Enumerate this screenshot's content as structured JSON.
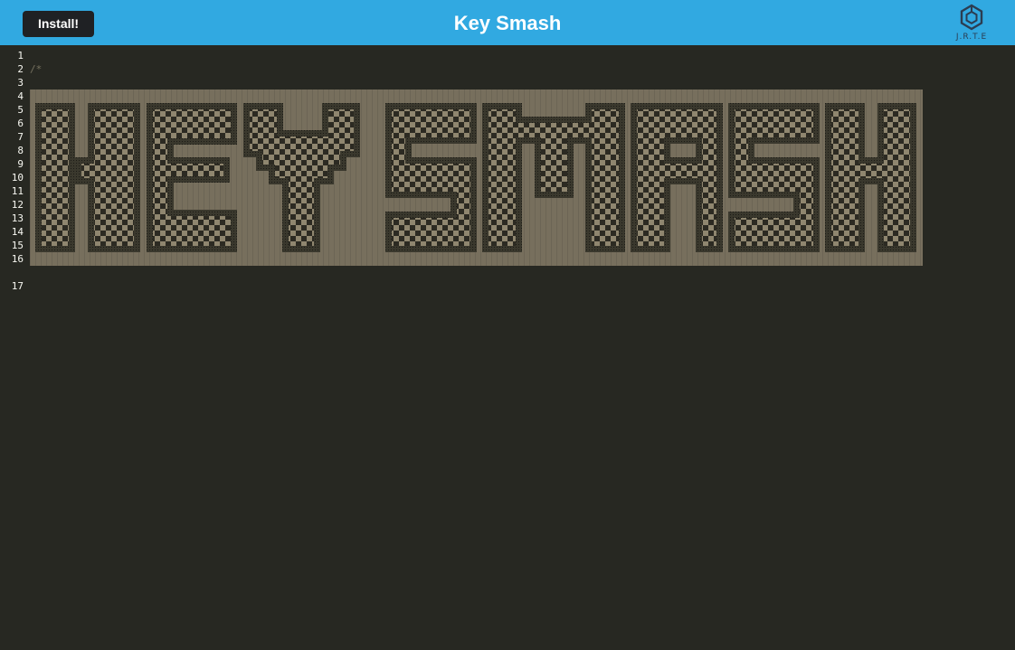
{
  "header": {
    "title": "Key Smash",
    "install_label": "Install!",
    "logo_text": "J.R.T.E",
    "background_color": "#31a9e1"
  },
  "editor": {
    "line_numbers": [
      "1",
      "2",
      "3",
      "4",
      "5",
      "6",
      "7",
      "8",
      "9",
      "10",
      "11",
      "12",
      "13",
      "14",
      "15",
      "16",
      "17"
    ],
    "code_lines": [
      {
        "line": "2",
        "text": "/*"
      }
    ],
    "ascii_art_text": "KEY SMASH",
    "background_color": "#272822",
    "art_background_color": "#776f5d"
  },
  "icons": {
    "logo": "jrte-cube-icon"
  }
}
